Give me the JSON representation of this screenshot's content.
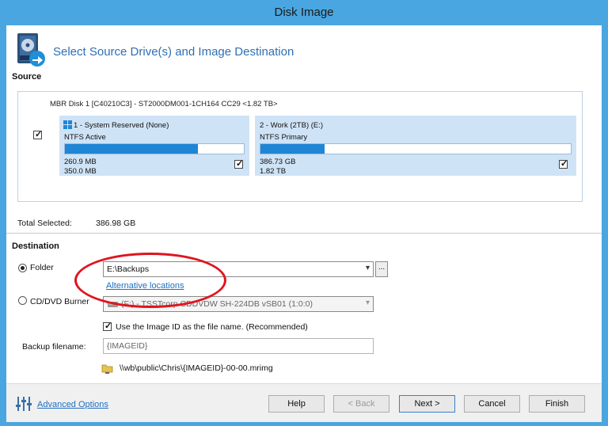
{
  "window": {
    "title": "Disk Image"
  },
  "header": {
    "title": "Select Source Drive(s) and Image Destination",
    "icon": "disk-image-icon"
  },
  "source": {
    "section_label": "Source",
    "disk_title": "MBR Disk 1 [C40210C3] - ST2000DM001-1CH164 CC29  <1.82 TB>",
    "disk_checked": true,
    "partitions": [
      {
        "name": "1 - System Reserved (None)",
        "type": "NTFS Active",
        "used": "260.9 MB",
        "total": "350.0 MB",
        "usage_fraction": 0.745,
        "checked": true,
        "icon": "windows-logo-icon"
      },
      {
        "name": "2 - Work (2TB) (E:)",
        "type": "NTFS Primary",
        "used": "386.73 GB",
        "total": "1.82 TB",
        "usage_fraction": 0.207,
        "checked": true
      }
    ],
    "total_selected_label": "Total Selected:",
    "total_selected_value": "386.98 GB"
  },
  "destination": {
    "section_label": "Destination",
    "folder_label": "Folder",
    "folder_selected": true,
    "folder_value": "E:\\Backups",
    "browse_label": "...",
    "alt_locations_link": "Alternative locations",
    "cd_label": "CD/DVD Burner",
    "cd_selected": false,
    "cd_value": "(F:) - TSSTcorp CDDVDW SH-224DB  vSB01 (1:0:0)",
    "use_image_id_label": "Use the Image ID as the file name.  (Recommended)",
    "use_image_id_checked": true,
    "backup_filename_label": "Backup filename:",
    "backup_filename_placeholder": "{IMAGEID}",
    "path_preview": "\\\\wb\\public\\Chris\\{IMAGEID}-00-00.mrimg"
  },
  "footer": {
    "advanced_options": "Advanced Options",
    "help": "Help",
    "back": "< Back",
    "next": "Next >",
    "cancel": "Cancel",
    "finish": "Finish"
  },
  "colors": {
    "accent": "#1f86d6",
    "title_bar": "#4aa6e0",
    "highlight": "#e0141e",
    "header_text": "#2f6fb3"
  }
}
